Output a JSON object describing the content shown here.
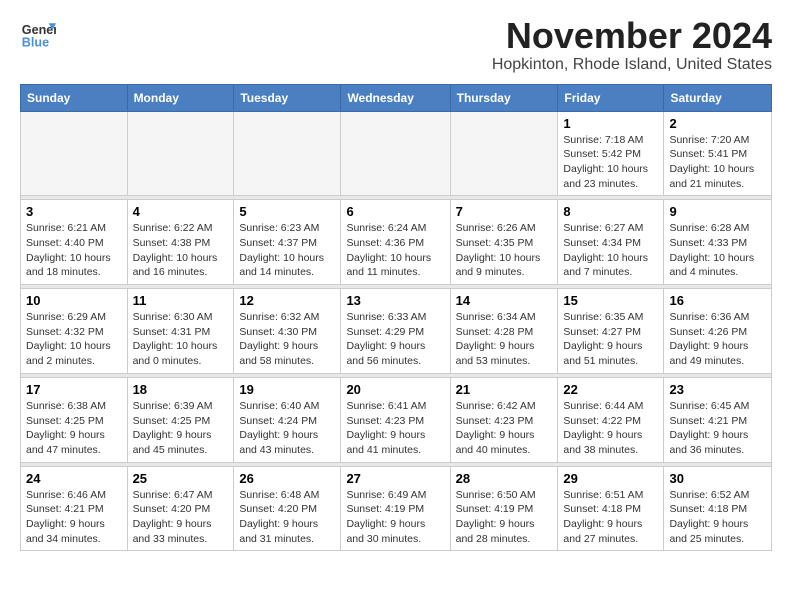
{
  "logo": {
    "line1": "General",
    "line2": "Blue"
  },
  "title": "November 2024",
  "location": "Hopkinton, Rhode Island, United States",
  "days_of_week": [
    "Sunday",
    "Monday",
    "Tuesday",
    "Wednesday",
    "Thursday",
    "Friday",
    "Saturday"
  ],
  "weeks": [
    [
      {
        "day": "",
        "info": ""
      },
      {
        "day": "",
        "info": ""
      },
      {
        "day": "",
        "info": ""
      },
      {
        "day": "",
        "info": ""
      },
      {
        "day": "",
        "info": ""
      },
      {
        "day": "1",
        "info": "Sunrise: 7:18 AM\nSunset: 5:42 PM\nDaylight: 10 hours\nand 23 minutes."
      },
      {
        "day": "2",
        "info": "Sunrise: 7:20 AM\nSunset: 5:41 PM\nDaylight: 10 hours\nand 21 minutes."
      }
    ],
    [
      {
        "day": "3",
        "info": "Sunrise: 6:21 AM\nSunset: 4:40 PM\nDaylight: 10 hours\nand 18 minutes."
      },
      {
        "day": "4",
        "info": "Sunrise: 6:22 AM\nSunset: 4:38 PM\nDaylight: 10 hours\nand 16 minutes."
      },
      {
        "day": "5",
        "info": "Sunrise: 6:23 AM\nSunset: 4:37 PM\nDaylight: 10 hours\nand 14 minutes."
      },
      {
        "day": "6",
        "info": "Sunrise: 6:24 AM\nSunset: 4:36 PM\nDaylight: 10 hours\nand 11 minutes."
      },
      {
        "day": "7",
        "info": "Sunrise: 6:26 AM\nSunset: 4:35 PM\nDaylight: 10 hours\nand 9 minutes."
      },
      {
        "day": "8",
        "info": "Sunrise: 6:27 AM\nSunset: 4:34 PM\nDaylight: 10 hours\nand 7 minutes."
      },
      {
        "day": "9",
        "info": "Sunrise: 6:28 AM\nSunset: 4:33 PM\nDaylight: 10 hours\nand 4 minutes."
      }
    ],
    [
      {
        "day": "10",
        "info": "Sunrise: 6:29 AM\nSunset: 4:32 PM\nDaylight: 10 hours\nand 2 minutes."
      },
      {
        "day": "11",
        "info": "Sunrise: 6:30 AM\nSunset: 4:31 PM\nDaylight: 10 hours\nand 0 minutes."
      },
      {
        "day": "12",
        "info": "Sunrise: 6:32 AM\nSunset: 4:30 PM\nDaylight: 9 hours\nand 58 minutes."
      },
      {
        "day": "13",
        "info": "Sunrise: 6:33 AM\nSunset: 4:29 PM\nDaylight: 9 hours\nand 56 minutes."
      },
      {
        "day": "14",
        "info": "Sunrise: 6:34 AM\nSunset: 4:28 PM\nDaylight: 9 hours\nand 53 minutes."
      },
      {
        "day": "15",
        "info": "Sunrise: 6:35 AM\nSunset: 4:27 PM\nDaylight: 9 hours\nand 51 minutes."
      },
      {
        "day": "16",
        "info": "Sunrise: 6:36 AM\nSunset: 4:26 PM\nDaylight: 9 hours\nand 49 minutes."
      }
    ],
    [
      {
        "day": "17",
        "info": "Sunrise: 6:38 AM\nSunset: 4:25 PM\nDaylight: 9 hours\nand 47 minutes."
      },
      {
        "day": "18",
        "info": "Sunrise: 6:39 AM\nSunset: 4:25 PM\nDaylight: 9 hours\nand 45 minutes."
      },
      {
        "day": "19",
        "info": "Sunrise: 6:40 AM\nSunset: 4:24 PM\nDaylight: 9 hours\nand 43 minutes."
      },
      {
        "day": "20",
        "info": "Sunrise: 6:41 AM\nSunset: 4:23 PM\nDaylight: 9 hours\nand 41 minutes."
      },
      {
        "day": "21",
        "info": "Sunrise: 6:42 AM\nSunset: 4:23 PM\nDaylight: 9 hours\nand 40 minutes."
      },
      {
        "day": "22",
        "info": "Sunrise: 6:44 AM\nSunset: 4:22 PM\nDaylight: 9 hours\nand 38 minutes."
      },
      {
        "day": "23",
        "info": "Sunrise: 6:45 AM\nSunset: 4:21 PM\nDaylight: 9 hours\nand 36 minutes."
      }
    ],
    [
      {
        "day": "24",
        "info": "Sunrise: 6:46 AM\nSunset: 4:21 PM\nDaylight: 9 hours\nand 34 minutes."
      },
      {
        "day": "25",
        "info": "Sunrise: 6:47 AM\nSunset: 4:20 PM\nDaylight: 9 hours\nand 33 minutes."
      },
      {
        "day": "26",
        "info": "Sunrise: 6:48 AM\nSunset: 4:20 PM\nDaylight: 9 hours\nand 31 minutes."
      },
      {
        "day": "27",
        "info": "Sunrise: 6:49 AM\nSunset: 4:19 PM\nDaylight: 9 hours\nand 30 minutes."
      },
      {
        "day": "28",
        "info": "Sunrise: 6:50 AM\nSunset: 4:19 PM\nDaylight: 9 hours\nand 28 minutes."
      },
      {
        "day": "29",
        "info": "Sunrise: 6:51 AM\nSunset: 4:18 PM\nDaylight: 9 hours\nand 27 minutes."
      },
      {
        "day": "30",
        "info": "Sunrise: 6:52 AM\nSunset: 4:18 PM\nDaylight: 9 hours\nand 25 minutes."
      }
    ]
  ]
}
